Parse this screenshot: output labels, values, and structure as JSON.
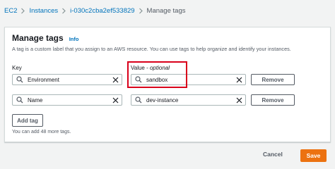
{
  "breadcrumb": {
    "items": [
      "EC2",
      "Instances",
      "i-030c2cba2ef533829",
      "Manage tags"
    ]
  },
  "panel": {
    "title": "Manage tags",
    "info_link": "Info",
    "description": "A tag is a custom label that you assign to an AWS resource. You can use tags to help organize and identify your instances."
  },
  "columns": {
    "key_label": "Key",
    "value_label": "Value",
    "value_suffix": "optional"
  },
  "tags": [
    {
      "key": "Environment",
      "value": "sandbox",
      "remove_label": "Remove"
    },
    {
      "key": "Name",
      "value": "dev-instance",
      "remove_label": "Remove"
    }
  ],
  "add_tag_label": "Add tag",
  "remaining_text": "You can add 48 more tags.",
  "footer": {
    "cancel_label": "Cancel",
    "save_label": "Save"
  },
  "colors": {
    "link": "#0073bb",
    "primary_button": "#ec7211",
    "highlight_box": "#d9001b"
  }
}
